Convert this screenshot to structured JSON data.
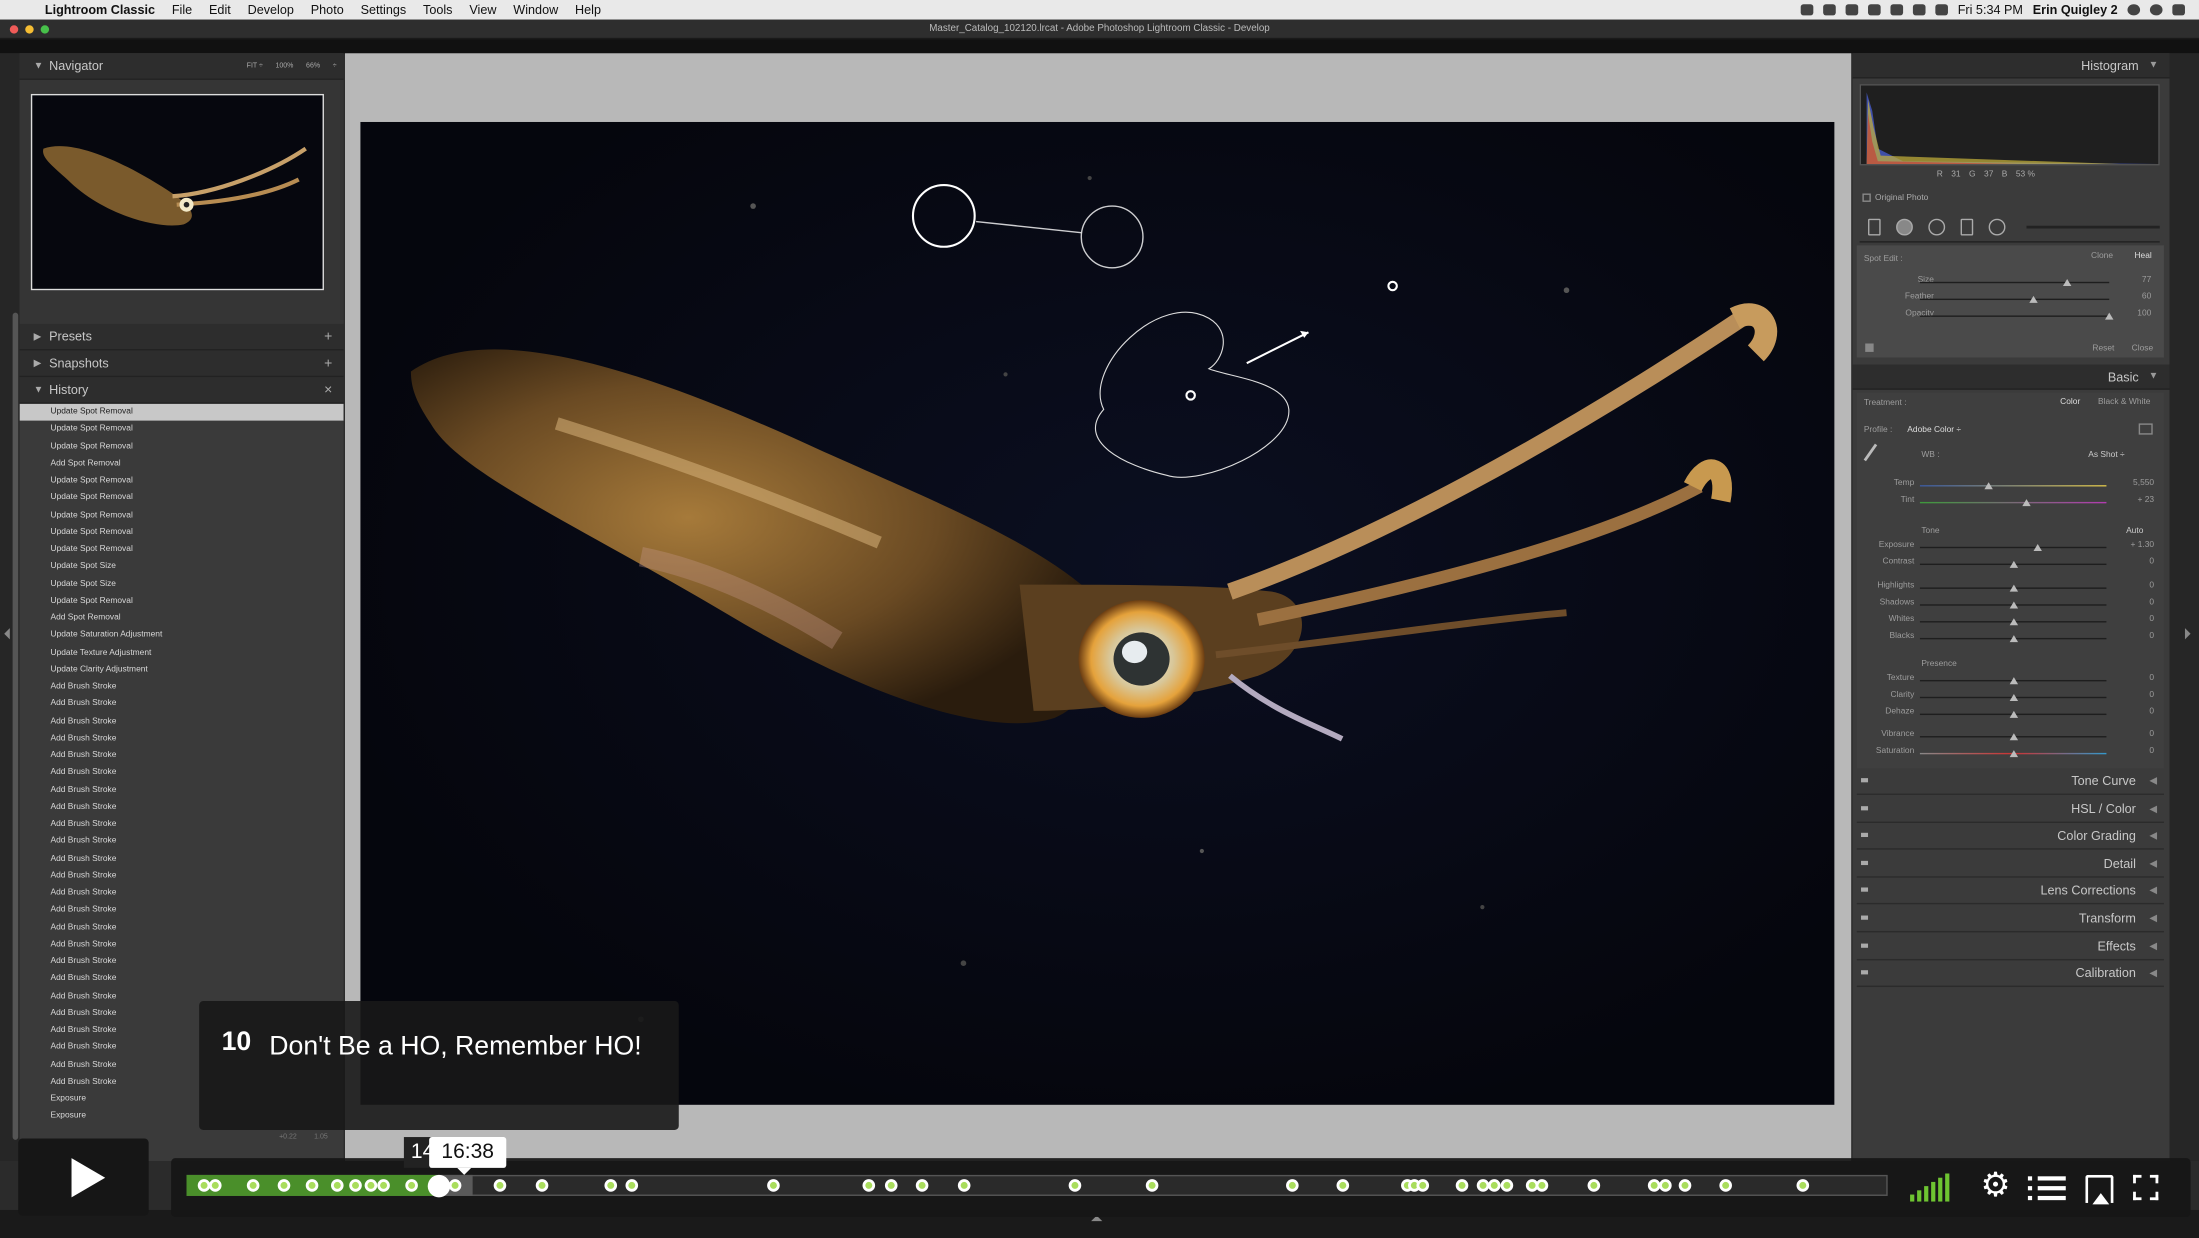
{
  "menubar": {
    "apple": "",
    "app_name": "Lightroom Classic",
    "items": [
      "File",
      "Edit",
      "Develop",
      "Photo",
      "Settings",
      "Tools",
      "View",
      "Window",
      "Help"
    ],
    "clock": "Fri 5:34 PM",
    "user": "Erin Quigley 2"
  },
  "window": {
    "title": "Master_Catalog_102120.lrcat - Adobe Photoshop Lightroom Classic - Develop"
  },
  "left_panel": {
    "navigator": {
      "label": "Navigator",
      "zoom_options": [
        "FIT ÷",
        "100%",
        "66%",
        "÷"
      ]
    },
    "presets": {
      "label": "Presets"
    },
    "snapshots": {
      "label": "Snapshots"
    },
    "history": {
      "label": "History",
      "items": [
        "Update Spot Removal",
        "Update Spot Removal",
        "Update Spot Removal",
        "Add Spot Removal",
        "Update Spot Removal",
        "Update Spot Removal",
        "Update Spot Removal",
        "Update Spot Removal",
        "Update Spot Removal",
        "Update Spot Size",
        "Update Spot Size",
        "Update Spot Removal",
        "Add Spot Removal",
        "Update Saturation Adjustment",
        "Update Texture Adjustment",
        "Update Clarity Adjustment",
        "Add Brush Stroke",
        "Add Brush Stroke",
        "Add Brush Stroke",
        "Add Brush Stroke",
        "Add Brush Stroke",
        "Add Brush Stroke",
        "Add Brush Stroke",
        "Add Brush Stroke",
        "Add Brush Stroke",
        "Add Brush Stroke",
        "Add Brush Stroke",
        "Add Brush Stroke",
        "Add Brush Stroke",
        "Add Brush Stroke",
        "Add Brush Stroke",
        "Add Brush Stroke",
        "Add Brush Stroke",
        "Add Brush Stroke",
        "Add Brush Stroke",
        "Add Brush Stroke",
        "Add Brush Stroke",
        "Add Brush Stroke",
        "Add Brush Stroke",
        "Add Brush Stroke",
        "Exposure",
        "Exposure"
      ],
      "footer_values": [
        "+0.22",
        "1.05"
      ]
    }
  },
  "right_panel": {
    "histogram": {
      "label": "Histogram",
      "readout": [
        "R",
        "31",
        "G",
        "37",
        "B",
        "53 %"
      ],
      "original_photo": "Original Photo"
    },
    "spot_edit": {
      "label": "Spot Edit :",
      "modes": [
        "Clone",
        "Heal"
      ],
      "sliders": [
        {
          "name": "Size",
          "value": "77",
          "pos": 0.78
        },
        {
          "name": "Feather",
          "value": "60",
          "pos": 0.6
        },
        {
          "name": "Opacity",
          "value": "100",
          "pos": 1.0
        }
      ],
      "reset": "Reset",
      "close": "Close"
    },
    "basic": {
      "label": "Basic",
      "treatment_label": "Treatment :",
      "treatment_options": [
        "Color",
        "Black & White"
      ],
      "profile_label": "Profile :",
      "profile_value": "Adobe Color ÷",
      "wb_label": "WB :",
      "wb_value": "As Shot ÷",
      "tone_label": "Tone",
      "auto_label": "Auto",
      "presence_label": "Presence",
      "sliders": [
        {
          "name": "Temp",
          "value": "5,550",
          "pos": 0.37
        },
        {
          "name": "Tint",
          "value": "+ 23",
          "pos": 0.57
        },
        {
          "name": "Exposure",
          "value": "+ 1.30",
          "pos": 0.63
        },
        {
          "name": "Contrast",
          "value": "0",
          "pos": 0.5
        },
        {
          "name": "Highlights",
          "value": "0",
          "pos": 0.5
        },
        {
          "name": "Shadows",
          "value": "0",
          "pos": 0.5
        },
        {
          "name": "Whites",
          "value": "0",
          "pos": 0.5
        },
        {
          "name": "Blacks",
          "value": "0",
          "pos": 0.5
        },
        {
          "name": "Texture",
          "value": "0",
          "pos": 0.5
        },
        {
          "name": "Clarity",
          "value": "0",
          "pos": 0.5
        },
        {
          "name": "Dehaze",
          "value": "0",
          "pos": 0.5
        },
        {
          "name": "Vibrance",
          "value": "0",
          "pos": 0.5
        },
        {
          "name": "Saturation",
          "value": "0",
          "pos": 0.5
        }
      ]
    },
    "sections": [
      "Tone Curve",
      "HSL / Color",
      "Color Grading",
      "Detail",
      "Lens Corrections",
      "Transform",
      "Effects",
      "Calibration"
    ]
  },
  "video_player": {
    "chapter_number": "10",
    "chapter_title": "Don't Be a HO, Remember HO!",
    "hover_time": "16:38",
    "partial_time": "14",
    "progress_fraction": 0.148,
    "chapter_marker_fractions": [
      0.01,
      0.017,
      0.039,
      0.057,
      0.074,
      0.089,
      0.099,
      0.108,
      0.116,
      0.132,
      0.147,
      0.158,
      0.184,
      0.209,
      0.249,
      0.262,
      0.345,
      0.401,
      0.414,
      0.432,
      0.457,
      0.522,
      0.568,
      0.65,
      0.68,
      0.718,
      0.722,
      0.727,
      0.75,
      0.762,
      0.769,
      0.776,
      0.791,
      0.797,
      0.827,
      0.863,
      0.869,
      0.881,
      0.905,
      0.95
    ],
    "accent_color": "#6ec431"
  }
}
